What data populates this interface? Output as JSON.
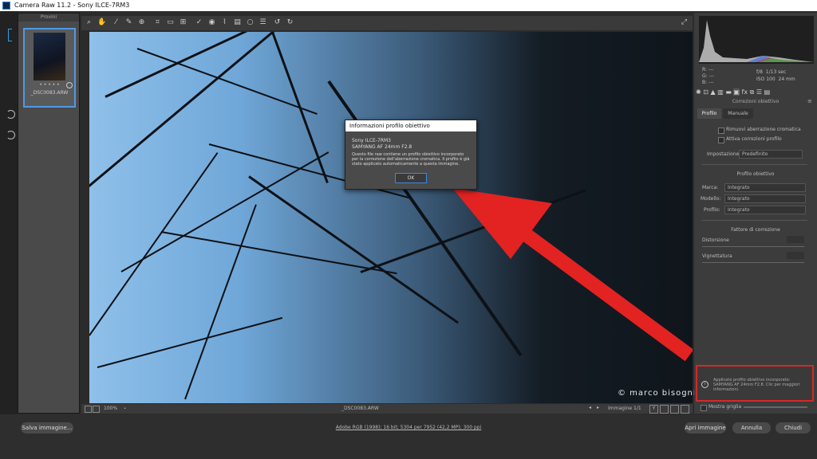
{
  "window": {
    "title": "Camera Raw 11.2  -  Sony ILCE-7RM3"
  },
  "filmstrip": {
    "header": "Provini",
    "items": [
      {
        "filename": "_DSC0083.ARW",
        "rating": "• • • • •"
      }
    ]
  },
  "preview": {
    "watermark": "© marco bisogni",
    "zoom": "100%",
    "filename": "_DSC0083.ARW",
    "counter": "Immagine 1/1"
  },
  "histogram": {
    "r_label": "R:",
    "g_label": "G:",
    "b_label": "B:",
    "r_val": "---",
    "g_val": "---",
    "b_val": "---",
    "aperture": "f/8",
    "shutter": "1/13 sec",
    "iso": "ISO 100",
    "focal": "24 mm"
  },
  "panel": {
    "title": "Correzioni obiettivo",
    "tabs": [
      "Profilo",
      "Manuale"
    ],
    "checkboxes": [
      "Rimuovi aberrazione cromatica",
      "Attiva correzioni profilo"
    ],
    "setting_label": "Impostazione:",
    "setting_value": "Predefinito",
    "profile_section": "Profilo obiettivo",
    "fields": [
      {
        "label": "Marca:",
        "value": "Integrato"
      },
      {
        "label": "Modello:",
        "value": "Integrato"
      },
      {
        "label": "Profilo:",
        "value": "Integrato"
      }
    ],
    "correction_section": "Fattore di correzione",
    "sliders": [
      {
        "label": "Distorsione"
      },
      {
        "label": "Vignettatura"
      }
    ],
    "info_text": "Applicato profilo obiettivo incorporato: SAMYANG AF 24mm F2.8. Clic per maggiori informazioni.",
    "grid_label": "Mostra griglia"
  },
  "dialog": {
    "title": "Informazioni profilo obiettivo",
    "line1": "Sony ILCE-7RM3",
    "line2": "SAMYANG AF 24mm F2.8",
    "body": "Questo file raw contiene un profilo obiettivo incorporato per la correzione dell'aberrazione cromatica. Il profilo è già stato applicato automaticamente a questa immagine.",
    "ok": "OK"
  },
  "bottom": {
    "save": "Salva immagine...",
    "workflow": "Adobe RGB (1998); 16 bit; 5304 per 7952 (42,2 MP); 300 ppi",
    "open": "Apri immagine",
    "cancel": "Annulla",
    "close": "Chiudi"
  },
  "colors": {
    "accent": "#3a8be0",
    "annotation_red": "#e32222"
  },
  "icons": [
    "zoom-icon",
    "hand-icon",
    "white-balance-icon",
    "color-sampler-icon",
    "target-adjust-icon",
    "crop-icon",
    "straighten-icon",
    "transform-icon",
    "spot-removal-icon",
    "red-eye-icon",
    "adjustment-brush-icon",
    "graduated-filter-icon",
    "radial-filter-icon",
    "preferences-icon",
    "rotate-ccw-icon",
    "rotate-cw-icon"
  ]
}
